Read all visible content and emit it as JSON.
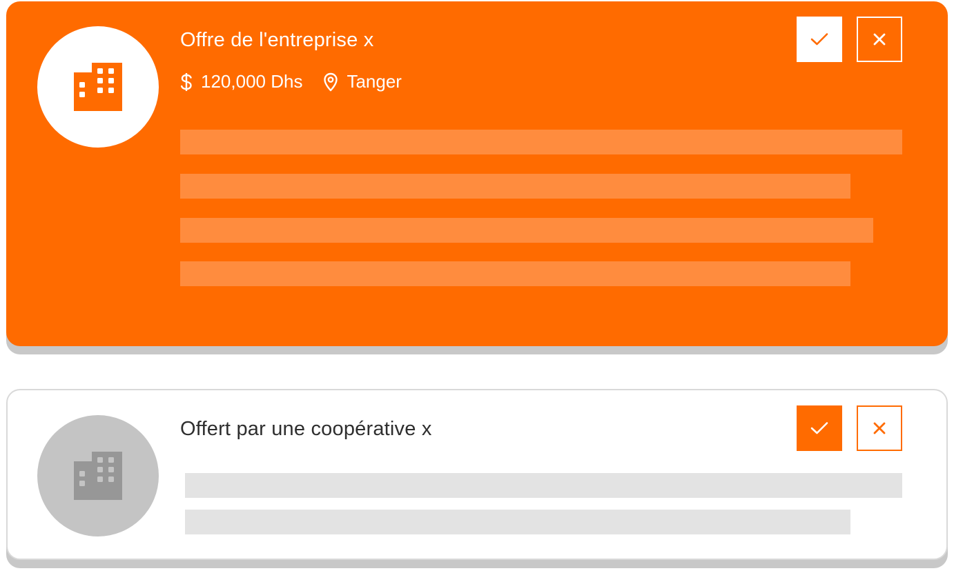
{
  "colors": {
    "accent": "#ff6b00",
    "accent_light": "#ff8c3e",
    "white": "#ffffff",
    "gray_avatar": "#c4c4c4",
    "gray_icon": "#979797",
    "gray_line": "#e3e3e3",
    "text_dark": "#2e2e2e"
  },
  "offers": [
    {
      "title": "Offre de l'entreprise x",
      "salary": "120,000 Dhs",
      "location": "Tanger",
      "icons": {
        "avatar": "building-icon",
        "salary": "dollar-icon",
        "location": "map-pin-icon",
        "accept": "check-icon",
        "reject": "close-icon"
      },
      "state": "active"
    },
    {
      "title": "Offert par une coopérative x",
      "icons": {
        "avatar": "building-icon",
        "accept": "check-icon",
        "reject": "close-icon"
      },
      "state": "inactive"
    }
  ]
}
